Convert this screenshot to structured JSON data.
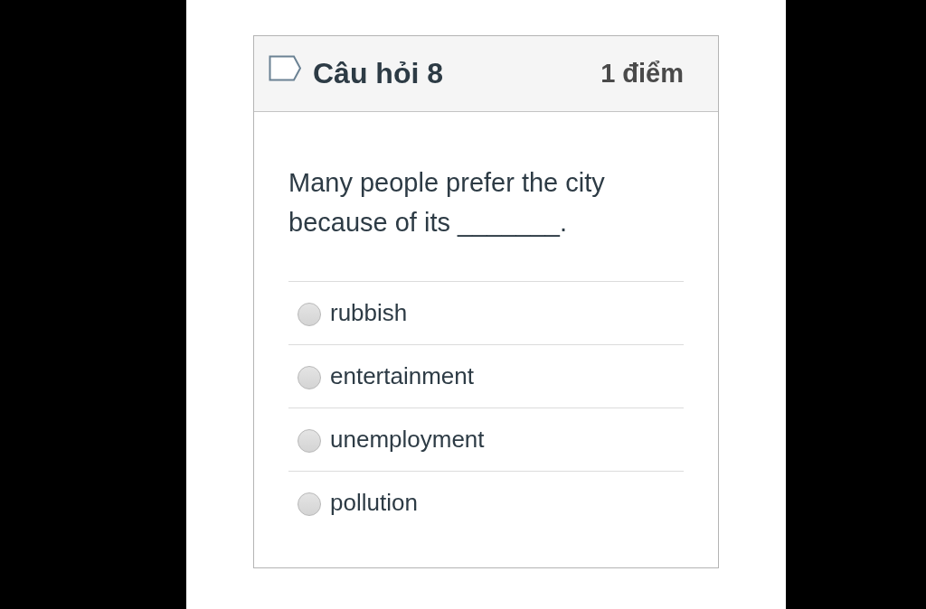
{
  "question": {
    "title": "Câu hỏi 8",
    "points": "1 điểm",
    "text": "Many people prefer the city because of its _______.",
    "options": [
      {
        "label": "rubbish",
        "selected": false
      },
      {
        "label": "entertainment",
        "selected": false
      },
      {
        "label": "unemployment",
        "selected": false
      },
      {
        "label": "pollution",
        "selected": false
      }
    ]
  }
}
